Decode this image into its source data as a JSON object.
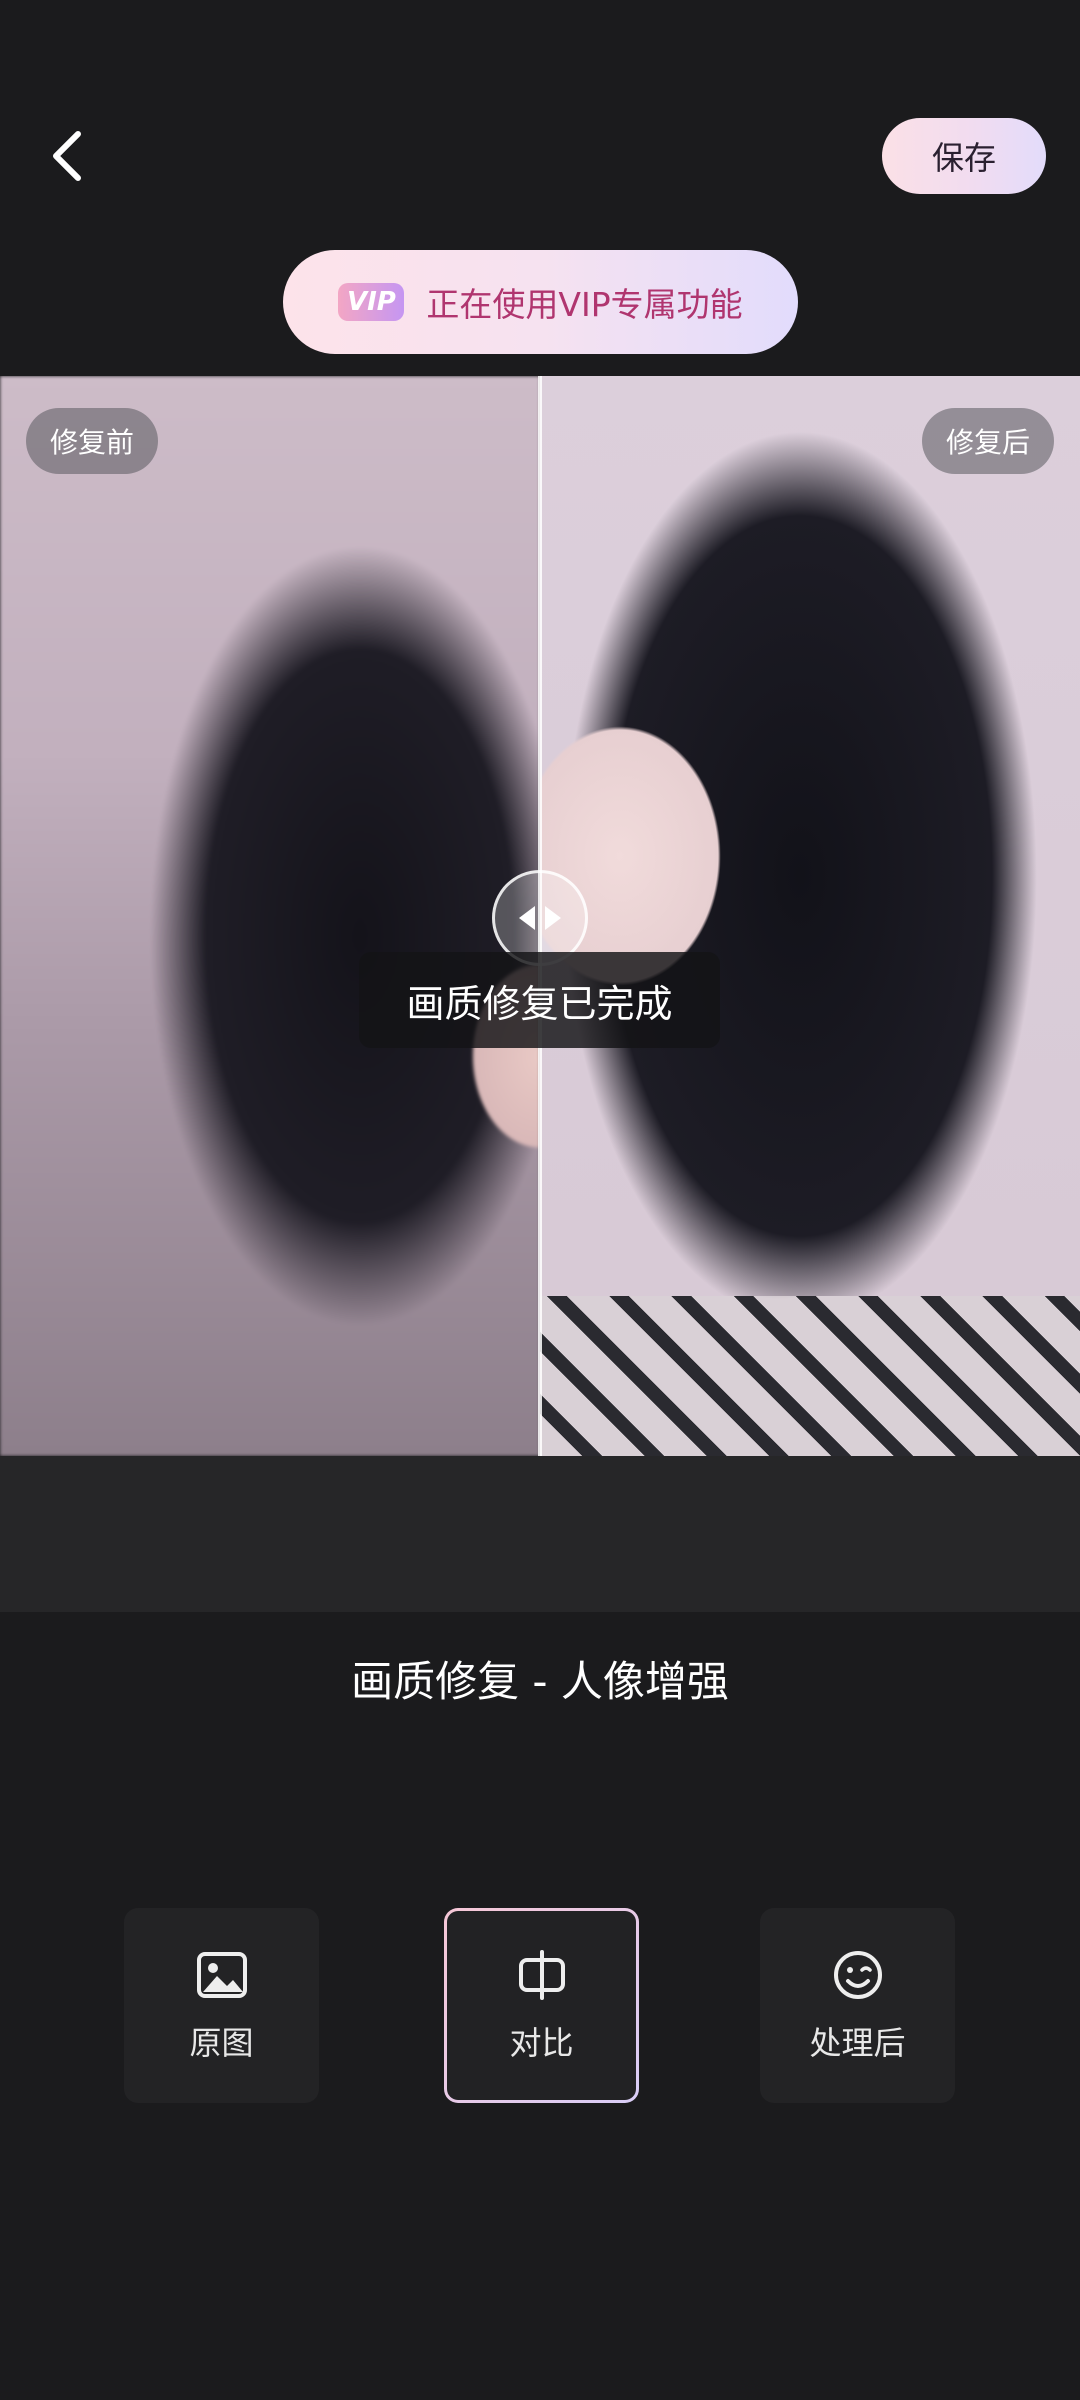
{
  "header": {
    "back_icon": "chevron-left-icon",
    "save_label": "保存"
  },
  "vip_banner": {
    "badge": "VIP",
    "text": "正在使用VIP专属功能"
  },
  "compare_view": {
    "before_label": "修复前",
    "after_label": "修复后",
    "toast": "画质修复已完成",
    "handle_icon": "left-right-arrows-icon"
  },
  "feature_title": "画质修复 - 人像增强",
  "options": [
    {
      "label": "原图",
      "icon": "image-icon"
    },
    {
      "label": "对比",
      "icon": "compare-icon",
      "selected": true
    },
    {
      "label": "处理后",
      "icon": "smile-icon"
    }
  ],
  "colors": {
    "background": "#1b1b1d",
    "accent_pink": "#f6c7d6",
    "accent_lavender": "#d9cdf7",
    "vip_text": "#b0356f"
  }
}
